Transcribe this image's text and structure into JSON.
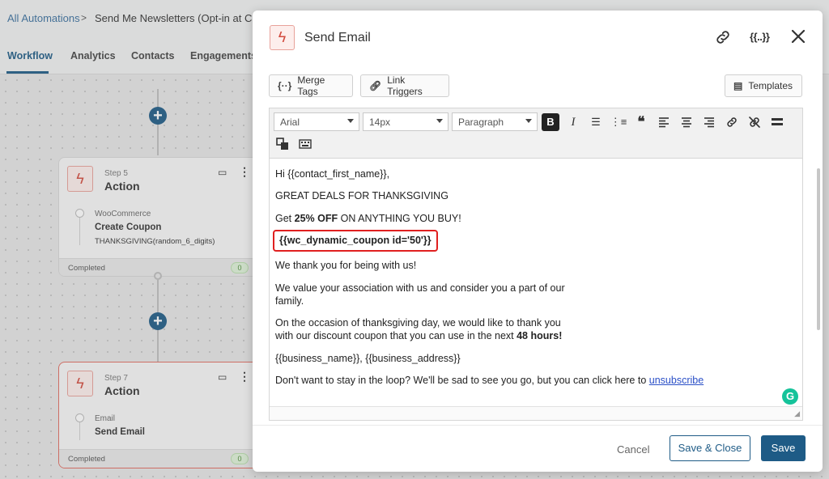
{
  "breadcrumb": {
    "root": "All Automations",
    "separator": ">",
    "current": "Send Me Newsletters (Opt-in at Check"
  },
  "tabs": [
    "Workflow",
    "Analytics",
    "Contacts",
    "Engagements"
  ],
  "workflow": {
    "step5": {
      "step_label": "Step 5",
      "title": "Action",
      "sub": "WooCommerce",
      "action": "Create Coupon",
      "detail": "THANKSGIVING(random_6_digits)",
      "status": "Completed",
      "count": "0"
    },
    "step7": {
      "step_label": "Step 7",
      "title": "Action",
      "sub": "Email",
      "action": "Send Email",
      "status": "Completed",
      "count": "0"
    }
  },
  "modal": {
    "title": "Send Email",
    "header_tags_icon": "{{..}}",
    "buttons": {
      "merge_tags": "Merge Tags",
      "link_triggers": "Link Triggers",
      "templates": "Templates"
    },
    "toolbar": {
      "font_family": "Arial",
      "font_size": "14px",
      "block_format": "Paragraph"
    },
    "content": {
      "greeting": "Hi {{contact_first_name}},",
      "headline": "GREAT DEALS FOR THANKSGIVING",
      "offer_prefix": "Get ",
      "offer_percent": "25%",
      "offer_off": " OFF",
      "offer_suffix": " ON ANYTHING YOU BUY!",
      "coupon_tag": "{{wc_dynamic_coupon id='50'}}",
      "thanks": "We thank you for being with us!",
      "value_line1": "We value your association with us and consider you a part of our",
      "value_line2": "family.",
      "occasion_line1": "On the occasion of thanksgiving day, we would like to thank you",
      "occasion_line2_prefix": "with our discount coupon that you can use in the next ",
      "occasion_hours": "48 hours!",
      "business": "{{business_name}}, {{business_address}}",
      "unsub_prefix": "Don't want to stay in the loop? We'll be sad to see you go, but you can click here to ",
      "unsub_link": "unsubscribe"
    },
    "footer": {
      "cancel": "Cancel",
      "save_close": "Save & Close",
      "save": "Save"
    }
  },
  "colors": {
    "accent": "#1e5b86",
    "coupon_highlight": "#e02020",
    "action_icon": "#d24b3e"
  }
}
